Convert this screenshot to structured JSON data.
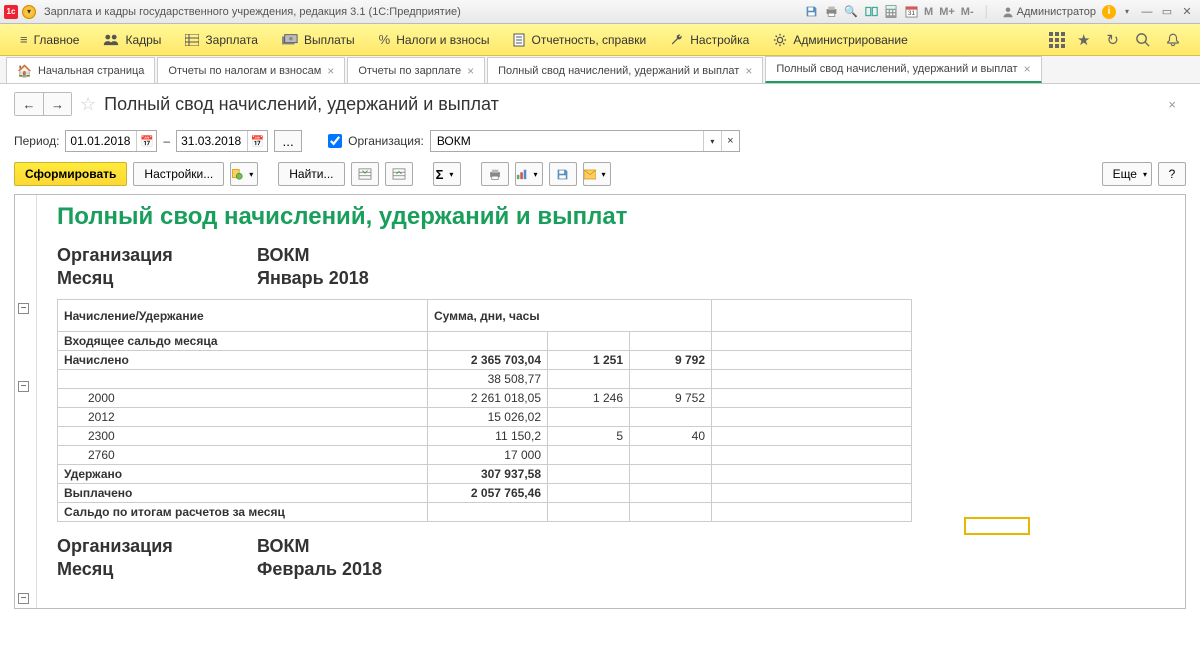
{
  "topbar": {
    "title": "Зарплата и кадры государственного учреждения, редакция 3.1  (1С:Предприятие)",
    "admin": "Администратор",
    "m1": "M",
    "m2": "M+",
    "m3": "M-"
  },
  "mainmenu": {
    "items": [
      "Главное",
      "Кадры",
      "Зарплата",
      "Выплаты",
      "Налоги и взносы",
      "Отчетность, справки",
      "Настройка",
      "Администрирование"
    ]
  },
  "tabs": {
    "t0": "Начальная страница",
    "t1": "Отчеты по налогам и взносам",
    "t2": "Отчеты по зарплате",
    "t3": "Полный свод начислений, удержаний и выплат",
    "t4": "Полный свод начислений, удержаний и выплат"
  },
  "page": {
    "title": "Полный свод начислений, удержаний и выплат"
  },
  "params": {
    "period_label": "Период:",
    "date_from": "01.01.2018",
    "date_to": "31.03.2018",
    "dash": "–",
    "org_label": "Организация:",
    "org_value": "ВОКМ"
  },
  "toolbar": {
    "generate": "Сформировать",
    "settings": "Настройки...",
    "find": "Найти...",
    "more": "Еще",
    "help": "?"
  },
  "report": {
    "title": "Полный свод начислений, удержаний и выплат",
    "meta_org_lbl": "Организация",
    "meta_org_val": "ВОКМ",
    "meta_month_lbl": "Месяц",
    "meta_month_val1": "Январь 2018",
    "meta_month_val2": "Февраль 2018",
    "col1": "Начисление/Удержание",
    "col2": "Сумма, дни, часы",
    "rows": {
      "r_in": "Входящее сальдо месяца",
      "r_acc": "Начислено",
      "r_acc_s": "2 365 703,04",
      "r_acc_c2": "1 251",
      "r_acc_c3": "9 792",
      "r_b": "",
      "r_b_s": "38 508,77",
      "r_2000": "2000",
      "r_2000_s": "2 261 018,05",
      "r_2000_c2": "1 246",
      "r_2000_c3": "9 752",
      "r_2012": "2012",
      "r_2012_s": "15 026,02",
      "r_2300": "2300",
      "r_2300_s": "11 150,2",
      "r_2300_c2": "5",
      "r_2300_c3": "40",
      "r_2760": "2760",
      "r_2760_s": "17 000",
      "r_ded": "Удержано",
      "r_ded_s": "307 937,58",
      "r_paid": "Выплачено",
      "r_paid_s": "2 057 765,46",
      "r_saldo": "Сальдо по итогам расчетов за месяц"
    }
  }
}
